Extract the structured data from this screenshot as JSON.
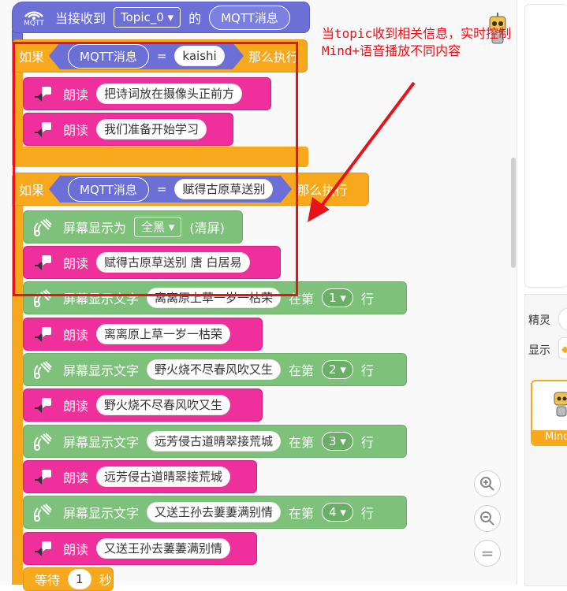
{
  "hat": {
    "prefix": "当接收到",
    "topic": "Topic_0 ▾",
    "mid": "的",
    "msg": "MQTT消息"
  },
  "if1": {
    "if": "如果",
    "msg": "MQTT消息",
    "eq": "=",
    "value": "kaishi",
    "then": "那么执行"
  },
  "if2": {
    "if": "如果",
    "msg": "MQTT消息",
    "eq": "=",
    "value": "赋得古原草送别",
    "then": "那么执行"
  },
  "read_label": "朗读",
  "screen_text_label": "屏幕显示文字",
  "row_prefix": "在第",
  "row_suffix": "行",
  "speak": [
    "把诗词放在摄像头正前方",
    "我们准备开始学习",
    "赋得古原草送别 唐 白居易",
    "离离原上草一岁一枯荣",
    " 野火烧不尽春风吹又生",
    "远芳侵古道晴翠接荒城",
    "又送王孙去萋萋满别情"
  ],
  "screen_fill": {
    "label": "屏幕显示为",
    "value": "全黑 ▾",
    "suffix": "(清屏)"
  },
  "screen_lines": [
    {
      "text": "离离原上草一岁一枯荣",
      "row": "1 ▾"
    },
    {
      "text": "野火烧不尽春风吹又生",
      "row": "2 ▾"
    },
    {
      "text": "远芳侵古道晴翠接荒城",
      "row": "3 ▾"
    },
    {
      "text": "又送王孙去萋萋满别情",
      "row": "4 ▾"
    }
  ],
  "wait": {
    "label": "等待",
    "value": "1",
    "unit": "秒"
  },
  "mqtt_icon_label": "MQTT",
  "annotation": "当topic收到相关信息，实时控制\nMind+语音播放不同内容",
  "zoom": {
    "in": "+",
    "out": "−",
    "reset": "="
  },
  "right_panel": {
    "sprite_label": "精灵",
    "display_label": "显示",
    "sprite_name": "Mind"
  },
  "colors": {
    "mqtt": "#6b6fd6",
    "control": "#f7a81c",
    "speaker": "#ef2f9b",
    "screen": "#7ec17a",
    "annotation": "#e8121a"
  }
}
